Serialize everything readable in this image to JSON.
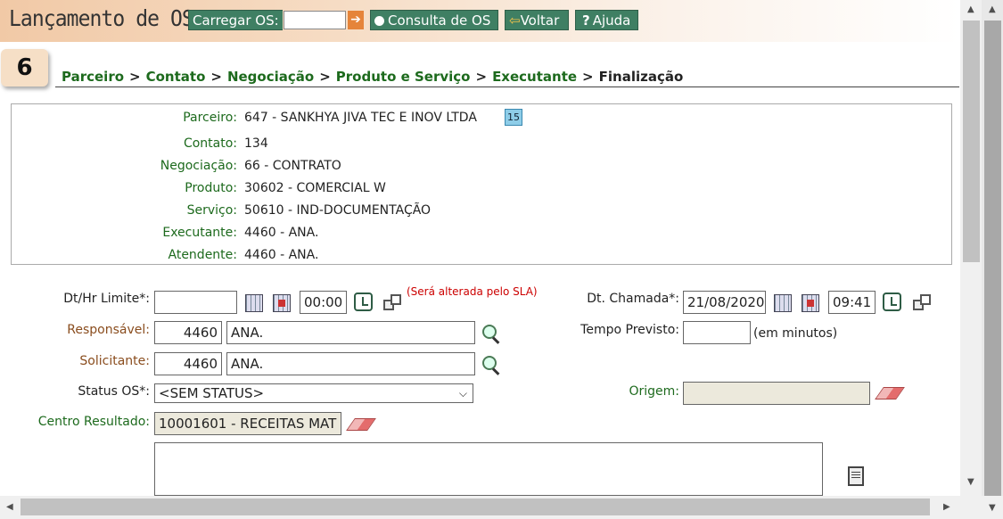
{
  "header": {
    "app_title": "Lançamento de OS",
    "carregar_label": "Carregar OS:",
    "carregar_value": "",
    "consulta_label": "Consulta de OS",
    "voltar_label": "Voltar",
    "ajuda_label": "Ajuda"
  },
  "wizard": {
    "step_number": "6",
    "breadcrumb": [
      "Parceiro",
      "Contato",
      "Negociação",
      "Produto e Serviço",
      "Executante",
      "Finalização"
    ],
    "separator": ">"
  },
  "summary": {
    "rows": [
      {
        "label": "Parceiro:",
        "value": "647 - SANKHYA JIVA TEC E INOV LTDA"
      },
      {
        "label": "Contato:",
        "value": "134"
      },
      {
        "label": "Negociação:",
        "value": "66 - CONTRATO"
      },
      {
        "label": "Produto:",
        "value": "30602 - COMERCIAL W"
      },
      {
        "label": "Serviço:",
        "value": "50610 - IND-DOCUMENTAÇÃO"
      },
      {
        "label": "Executante:",
        "value": "4460 - ANA."
      },
      {
        "label": "Atendente:",
        "value": "4460 - ANA."
      }
    ],
    "calendar_badge": "15"
  },
  "form": {
    "dt_limite": {
      "label": "Dt/Hr Limite*:",
      "date": "",
      "time": "00:00",
      "note": "(Será alterada pelo SLA)"
    },
    "dt_chamada": {
      "label": "Dt. Chamada*:",
      "date": "21/08/2020",
      "time": "09:41"
    },
    "responsavel": {
      "label": "Responsável:",
      "code": "4460",
      "name": "ANA."
    },
    "tempo_previsto": {
      "label": "Tempo Previsto:",
      "value": "",
      "unit": "(em minutos)"
    },
    "solicitante": {
      "label": "Solicitante:",
      "code": "4460",
      "name": "ANA."
    },
    "status_os": {
      "label": "Status OS*:",
      "selected": "<SEM STATUS>"
    },
    "origem": {
      "label": "Origem:",
      "value": ""
    },
    "centro_resultado": {
      "label": "Centro Resultado:",
      "value": "10001601 - RECEITAS MAT"
    }
  }
}
